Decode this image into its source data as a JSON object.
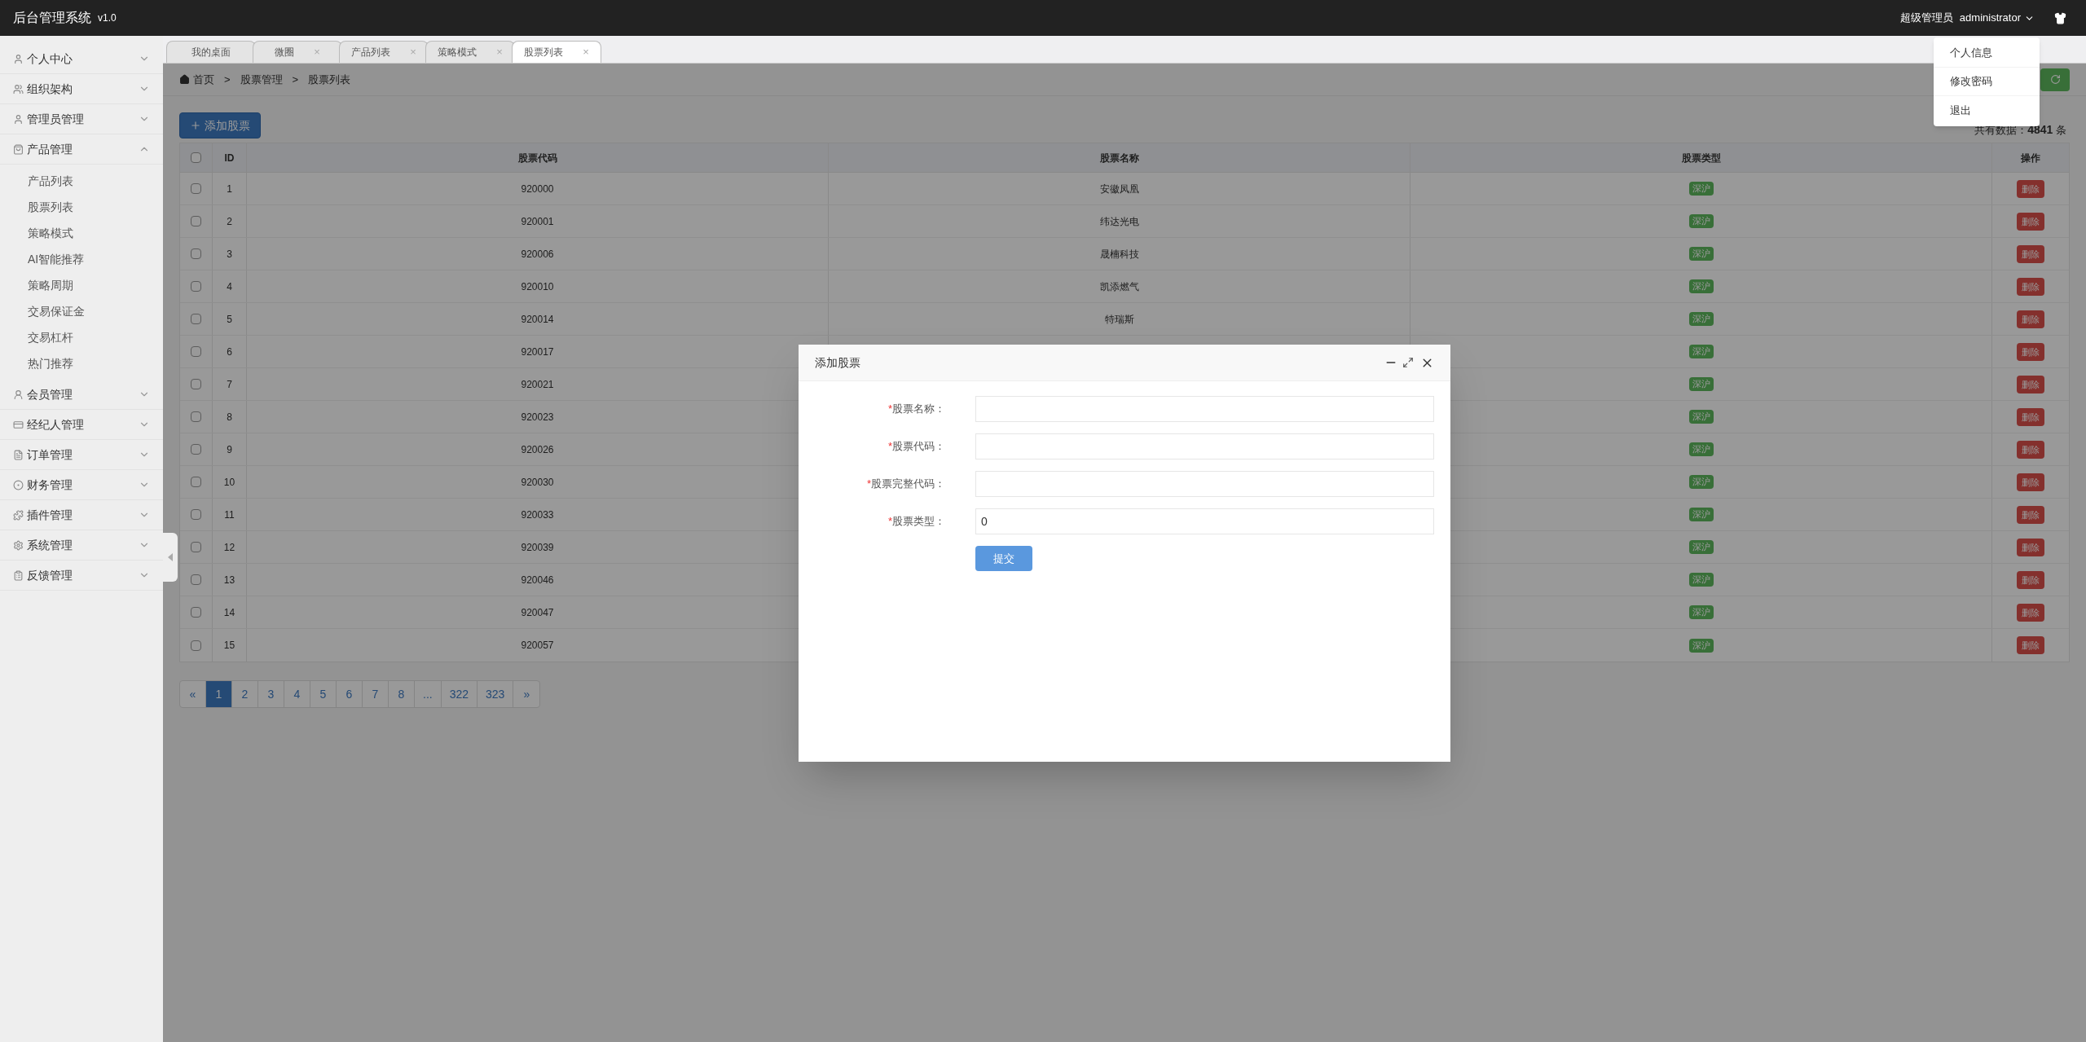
{
  "header": {
    "title": "后台管理系统",
    "version": "v1.0",
    "role": "超级管理员",
    "user": "administrator"
  },
  "user_menu": {
    "open": true,
    "items": [
      "个人信息",
      "修改密码",
      "退出"
    ]
  },
  "sidebar": {
    "items": [
      {
        "label": "个人中心",
        "expanded": false
      },
      {
        "label": "组织架构",
        "expanded": false
      },
      {
        "label": "管理员管理",
        "expanded": false
      },
      {
        "label": "产品管理",
        "expanded": true,
        "children": [
          {
            "label": "产品列表"
          },
          {
            "label": "股票列表"
          },
          {
            "label": "策略模式"
          },
          {
            "label": "AI智能推荐"
          },
          {
            "label": "策略周期"
          },
          {
            "label": "交易保证金"
          },
          {
            "label": "交易杠杆"
          },
          {
            "label": "热门推荐"
          }
        ]
      },
      {
        "label": "会员管理",
        "expanded": false
      },
      {
        "label": "经纪人管理",
        "expanded": false
      },
      {
        "label": "订单管理",
        "expanded": false
      },
      {
        "label": "财务管理",
        "expanded": false
      },
      {
        "label": "插件管理",
        "expanded": false
      },
      {
        "label": "系统管理",
        "expanded": false
      },
      {
        "label": "反馈管理",
        "expanded": false
      }
    ]
  },
  "tabs": [
    {
      "label": "我的桌面",
      "closable": false,
      "selected": false
    },
    {
      "label": "微圈",
      "closable": true,
      "selected": false
    },
    {
      "label": "产品列表",
      "closable": true,
      "selected": false
    },
    {
      "label": "策略模式",
      "closable": true,
      "selected": false
    },
    {
      "label": "股票列表",
      "closable": true,
      "selected": true
    }
  ],
  "close_glyph": "×",
  "breadcrumb": [
    "首页",
    "股票管理",
    "股票列表"
  ],
  "breadcrumb_separator": ">",
  "add_button": "添加股票",
  "total": {
    "prefix": "共有数据：",
    "count": "4841",
    "suffix": "条"
  },
  "table": {
    "all_checked": false,
    "columns": [
      "ID",
      "股票代码",
      "股票名称",
      "股票类型",
      "操作"
    ],
    "rows": [
      {
        "checked": false,
        "id": "1",
        "code": "920000",
        "name": "安徽凤凰",
        "type": "深沪",
        "action": "删除"
      },
      {
        "checked": false,
        "id": "2",
        "code": "920001",
        "name": "纬达光电",
        "type": "深沪",
        "action": "删除"
      },
      {
        "checked": false,
        "id": "3",
        "code": "920006",
        "name": "晟楠科技",
        "type": "深沪",
        "action": "删除"
      },
      {
        "checked": false,
        "id": "4",
        "code": "920010",
        "name": "凯添燃气",
        "type": "深沪",
        "action": "删除"
      },
      {
        "checked": false,
        "id": "5",
        "code": "920014",
        "name": "特瑞斯",
        "type": "深沪",
        "action": "删除"
      },
      {
        "checked": false,
        "id": "6",
        "code": "920017",
        "type": "深沪",
        "action": "删除"
      },
      {
        "checked": false,
        "id": "7",
        "code": "920021",
        "type": "深沪",
        "action": "删除"
      },
      {
        "checked": false,
        "id": "8",
        "code": "920023",
        "type": "深沪",
        "action": "删除"
      },
      {
        "checked": false,
        "id": "9",
        "code": "920026",
        "type": "深沪",
        "action": "删除"
      },
      {
        "checked": false,
        "id": "10",
        "code": "920030",
        "type": "深沪",
        "action": "删除"
      },
      {
        "checked": false,
        "id": "11",
        "code": "920033",
        "type": "深沪",
        "action": "删除"
      },
      {
        "checked": false,
        "id": "12",
        "code": "920039",
        "type": "深沪",
        "action": "删除"
      },
      {
        "checked": false,
        "id": "13",
        "code": "920046",
        "type": "深沪",
        "action": "删除"
      },
      {
        "checked": false,
        "id": "14",
        "code": "920047",
        "type": "深沪",
        "action": "删除"
      },
      {
        "checked": false,
        "id": "15",
        "code": "920057",
        "type": "深沪",
        "action": "删除"
      }
    ]
  },
  "pagination": [
    {
      "label": "«",
      "selected": false
    },
    {
      "label": "1",
      "selected": true
    },
    {
      "label": "2",
      "selected": false
    },
    {
      "label": "3",
      "selected": false
    },
    {
      "label": "4",
      "selected": false
    },
    {
      "label": "5",
      "selected": false
    },
    {
      "label": "6",
      "selected": false
    },
    {
      "label": "7",
      "selected": false
    },
    {
      "label": "8",
      "selected": false
    },
    {
      "label": "...",
      "selected": false
    },
    {
      "label": "322",
      "selected": false
    },
    {
      "label": "323",
      "selected": false
    },
    {
      "label": "»",
      "selected": false
    }
  ],
  "dialog": {
    "title": "添加股票",
    "fields": [
      {
        "label": "股票名称：",
        "required": true
      },
      {
        "label": "股票代码：",
        "required": true
      },
      {
        "label": "股票完整代码：",
        "required": true
      },
      {
        "label": "股票类型：",
        "required": true,
        "value": "0"
      }
    ],
    "required_mark": "*",
    "submit": "提交"
  }
}
